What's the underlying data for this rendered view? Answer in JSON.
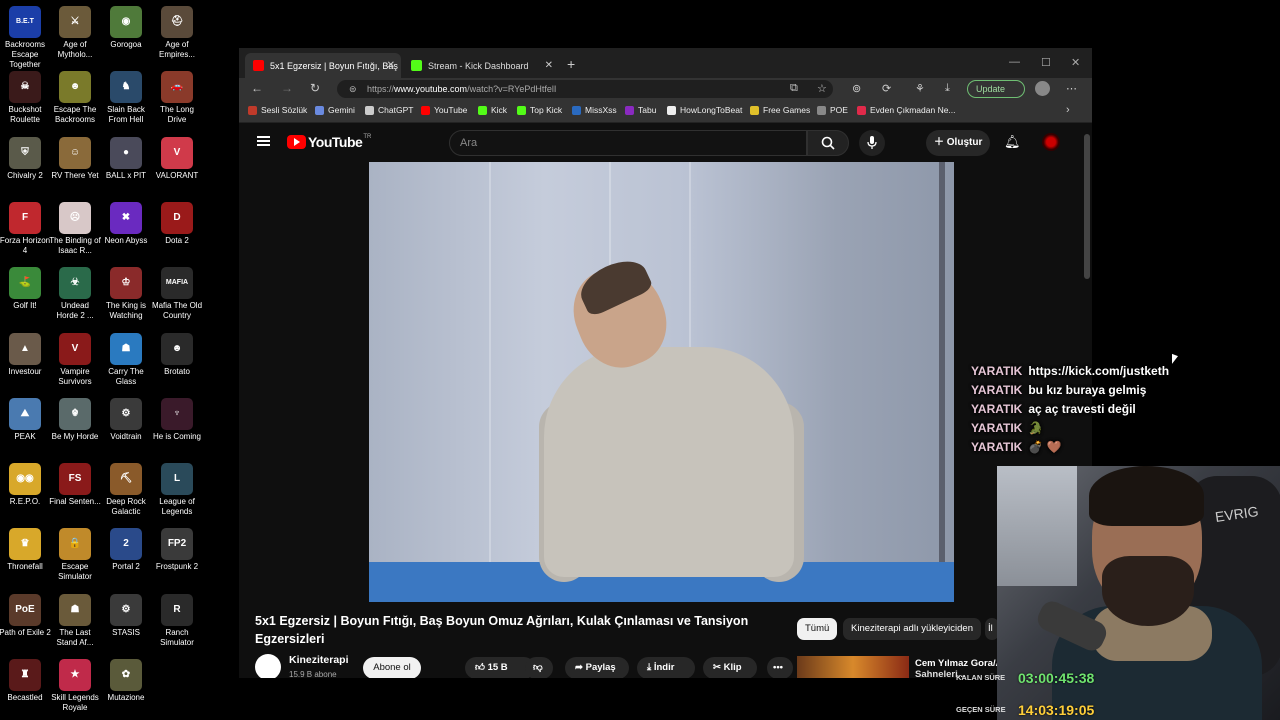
{
  "desktop": {
    "icons": [
      {
        "label": "Backrooms Escape Together",
        "glyph": "B.E.T",
        "color": "#1b3ea8"
      },
      {
        "label": "Age of Mytholo...",
        "glyph": "⚔",
        "color": "#6b5a3a"
      },
      {
        "label": "Gorogoa",
        "glyph": "◉",
        "color": "#4f7a3a"
      },
      {
        "label": "Age of Empires...",
        "glyph": "⛑",
        "color": "#5a4a3a"
      },
      {
        "label": "Buckshot Roulette",
        "glyph": "☠",
        "color": "#3a1a1a"
      },
      {
        "label": "Escape The Backrooms",
        "glyph": "☻",
        "color": "#7a7a2a"
      },
      {
        "label": "Slain Back From Hell",
        "glyph": "♞",
        "color": "#2a4a6a"
      },
      {
        "label": "The Long Drive",
        "glyph": "🚗",
        "color": "#8a3a2a"
      },
      {
        "label": "Chivalry 2",
        "glyph": "⛨",
        "color": "#5a5a4a"
      },
      {
        "label": "RV There Yet",
        "glyph": "☺",
        "color": "#8a6a3a"
      },
      {
        "label": "BALL x PIT",
        "glyph": "●",
        "color": "#4a4a5a"
      },
      {
        "label": "VALORANT",
        "glyph": "V",
        "color": "#d03a4a"
      },
      {
        "label": "Forza Horizon 4",
        "glyph": "F",
        "color": "#c0282e"
      },
      {
        "label": "The Binding of Isaac R...",
        "glyph": "☹",
        "color": "#d8c8c8"
      },
      {
        "label": "Neon Abyss",
        "glyph": "✖",
        "color": "#6a2ac0"
      },
      {
        "label": "Dota 2",
        "glyph": "D",
        "color": "#9a1a1a"
      },
      {
        "label": "Golf It!",
        "glyph": "⛳",
        "color": "#3a8a3a"
      },
      {
        "label": "Undead Horde 2 ...",
        "glyph": "☣",
        "color": "#2a6a4a"
      },
      {
        "label": "The King is Watching",
        "glyph": "♔",
        "color": "#8a2a2a"
      },
      {
        "label": "Mafia The Old Country",
        "glyph": "MAFIA",
        "color": "#2a2a2a"
      },
      {
        "label": "Investour",
        "glyph": "▲",
        "color": "#6a5a4a"
      },
      {
        "label": "Vampire Survivors",
        "glyph": "V",
        "color": "#8a1a1a"
      },
      {
        "label": "Carry The Glass",
        "glyph": "☗",
        "color": "#2a7ac0"
      },
      {
        "label": "Brotato",
        "glyph": "☻",
        "color": "#2a2a2a"
      },
      {
        "label": "PEAK",
        "glyph": "⛰",
        "color": "#4a7ab0"
      },
      {
        "label": "Be My Horde",
        "glyph": "☬",
        "color": "#5a6a6a"
      },
      {
        "label": "Voidtrain",
        "glyph": "⚙",
        "color": "#3a3a3a"
      },
      {
        "label": "He is Coming",
        "glyph": "♆",
        "color": "#3a1a2a"
      },
      {
        "label": "R.E.P.O.",
        "glyph": "◉◉",
        "color": "#d8a82a"
      },
      {
        "label": "Final Senten...",
        "glyph": "FS",
        "color": "#8a1a1a"
      },
      {
        "label": "Deep Rock Galactic",
        "glyph": "⛏",
        "color": "#8a5a2a"
      },
      {
        "label": "League of Legends",
        "glyph": "L",
        "color": "#2a4a5a"
      },
      {
        "label": "Thronefall",
        "glyph": "♛",
        "color": "#d8a82a"
      },
      {
        "label": "Escape Simulator",
        "glyph": "🔒",
        "color": "#c08a2a"
      },
      {
        "label": "Portal 2",
        "glyph": "2",
        "color": "#2a4a8a"
      },
      {
        "label": "Frostpunk 2",
        "glyph": "FP2",
        "color": "#3a3a3a"
      },
      {
        "label": "Path of Exile 2",
        "glyph": "PoE",
        "color": "#5a3a2a"
      },
      {
        "label": "The Last Stand Af...",
        "glyph": "☗",
        "color": "#6a5a3a"
      },
      {
        "label": "STASIS",
        "glyph": "⚙",
        "color": "#3a3a3a"
      },
      {
        "label": "Ranch Simulator",
        "glyph": "R",
        "color": "#2a2a2a"
      },
      {
        "label": "Becastled",
        "glyph": "♜",
        "color": "#5a1a1a"
      },
      {
        "label": "Skill Legends Royale",
        "glyph": "★",
        "color": "#c02a4a"
      },
      {
        "label": "Mutazione",
        "glyph": "✿",
        "color": "#5a5a3a"
      }
    ]
  },
  "browser": {
    "tabs": [
      {
        "title": "5x1 Egzersiz | Boyun Fıtığı, Baş Bo",
        "color": "#ff0000",
        "active": true
      },
      {
        "title": "Stream - Kick Dashboard",
        "color": "#53fc18",
        "active": false
      }
    ],
    "url_prefix": "https://",
    "url_host": "www.youtube.com",
    "url_path": "/watch?v=RYePdHtfelI",
    "update_label": "Update",
    "bookmarks": [
      {
        "label": "Sesli Sözlük",
        "color": "#c03a2a"
      },
      {
        "label": "Gemini",
        "color": "#6a8ae0"
      },
      {
        "label": "ChatGPT",
        "color": "#cccccc"
      },
      {
        "label": "YouTube",
        "color": "#ff0000"
      },
      {
        "label": "Kick",
        "color": "#53fc18"
      },
      {
        "label": "Top Kick",
        "color": "#53fc18"
      },
      {
        "label": "MissXss",
        "color": "#2a6ac0"
      },
      {
        "label": "Tabu",
        "color": "#8a2ac0"
      },
      {
        "label": "HowLongToBeat",
        "color": "#eeeeee"
      },
      {
        "label": "Free Games",
        "color": "#e0c02a"
      },
      {
        "label": "POE",
        "color": "#888888"
      },
      {
        "label": "Evden Çıkmadan Ne...",
        "color": "#e02a4a"
      }
    ]
  },
  "youtube": {
    "logo_text": "YouTube",
    "logo_suffix": "TR",
    "search_placeholder": "Ara",
    "create_label": "Oluştur",
    "video_title": "5x1 Egzersiz | Boyun Fıtığı, Baş Boyun Omuz Ağrıları, Kulak Çınlaması ve Tansiyon Egzersizleri",
    "channel_name": "Kineziterapi",
    "channel_subs": "15.9 B abone",
    "subscribe_label": "Abone ol",
    "like_count": "15 B",
    "share_label": "Paylaş",
    "download_label": "İndir",
    "clip_label": "Klip",
    "chips": [
      "Tümü",
      "Kineziterapi adlı yükleyiciden",
      "İl"
    ],
    "rec_title": "Cem Yılmaz Gora/A...",
    "rec_subtitle": "Sahneleri..."
  },
  "chat": [
    {
      "user": "YARATIK",
      "msg": "https://kick.com/justketh"
    },
    {
      "user": "YARATIK",
      "msg": "bu kız buraya gelmiş"
    },
    {
      "user": "YARATIK",
      "msg": "aç aç travesti değil"
    },
    {
      "user": "YARATIK",
      "msg": "🐊"
    },
    {
      "user": "YARATIK",
      "msg": "💣 🤎"
    }
  ],
  "overlay": {
    "webcam_chair_text": "EVRIG",
    "remaining_label": "KALAN SÜRE",
    "remaining_value": "03:00:45:38",
    "elapsed_label": "GEÇEN SÜRE",
    "elapsed_value": "14:03:19:05"
  }
}
